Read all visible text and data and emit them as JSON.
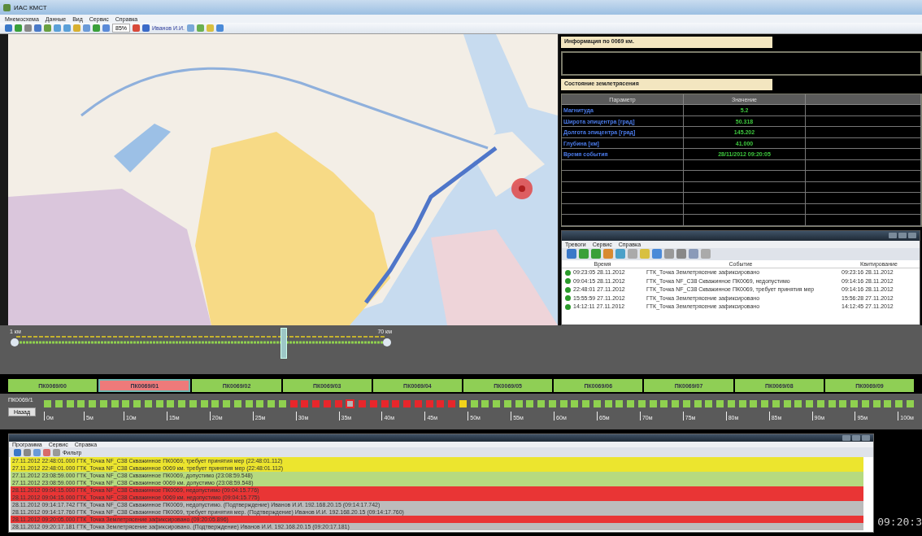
{
  "window": {
    "title": "ИАС КМСТ"
  },
  "menu": [
    "Мнемосхема",
    "Данные",
    "Вид",
    "Сервис",
    "Справка"
  ],
  "toolbar": {
    "zoom": "85%",
    "user": "Иванов И.И."
  },
  "info_panel": {
    "title": "Информация по 0069 км."
  },
  "quake_panel": {
    "title": "Состояние землетрясения",
    "columns": [
      "Параметр",
      "Значение"
    ],
    "rows": [
      {
        "parameter": "Магнитуда",
        "value": "5.2"
      },
      {
        "parameter": "Широта эпицентра [град]",
        "value": "50.318"
      },
      {
        "parameter": "Долгота эпицентра [град]",
        "value": "145.202"
      },
      {
        "parameter": "Глубина [км]",
        "value": "41.000"
      },
      {
        "parameter": "Время события",
        "value": "28/11/2012 09:20:05"
      }
    ]
  },
  "alarm_window": {
    "menu": [
      "Тревоги",
      "Сервис",
      "Справка"
    ],
    "columns": [
      "Время",
      "Событие",
      "Квитирование"
    ],
    "rows": [
      {
        "time": "09:23:05 28.11.2012",
        "event": "ГТК_Точка Землетрясение зафиксировано",
        "ack": "09:23:16 28.11.2012"
      },
      {
        "time": "09:04:15 28.11.2012",
        "event": "ГТК_Точка NF_C38 Скважинное ПК0069, недопустимо",
        "ack": "09:14:16 28.11.2012"
      },
      {
        "time": "22:48:01 27.11.2012",
        "event": "ГТК_Точка NF_C38 Скважинное ПК0069, требует принятия мер",
        "ack": "09:14:16 28.11.2012"
      },
      {
        "time": "15:55:59 27.11.2012",
        "event": "ГТК_Точка Землетрясение зафиксировано",
        "ack": "15:56:28 27.11.2012"
      },
      {
        "time": "14:12:11 27.11.2012",
        "event": "ГТК_Точка Землетрясение зафиксировано",
        "ack": "14:12:45 27.11.2012"
      }
    ]
  },
  "track": {
    "start_label": "1 км",
    "end_label": "70 км"
  },
  "segments": [
    {
      "label": "ПК0069/00",
      "selected": false
    },
    {
      "label": "ПК0069/01",
      "selected": true
    },
    {
      "label": "ПК0069/02",
      "selected": false
    },
    {
      "label": "ПК0069/03",
      "selected": false
    },
    {
      "label": "ПК0069/04",
      "selected": false
    },
    {
      "label": "ПК0069/05",
      "selected": false
    },
    {
      "label": "ПК0069/06",
      "selected": false
    },
    {
      "label": "ПК0069/07",
      "selected": false
    },
    {
      "label": "ПК0069/08",
      "selected": false
    },
    {
      "label": "ПК0069/09",
      "selected": false
    }
  ],
  "section": {
    "label": "ПК0069/1",
    "back_button": "Назад",
    "cells": [
      {
        "color": "#8fd14f",
        "selected": false
      },
      {
        "color": "#8fd14f",
        "selected": false
      },
      {
        "color": "#8fd14f",
        "selected": false
      },
      {
        "color": "#8fd14f",
        "selected": false
      },
      {
        "color": "#8fd14f",
        "selected": false
      },
      {
        "color": "#8fd14f",
        "selected": false
      },
      {
        "color": "#8fd14f",
        "selected": false
      },
      {
        "color": "#8fd14f",
        "selected": false
      },
      {
        "color": "#8fd14f",
        "selected": false
      },
      {
        "color": "#8fd14f",
        "selected": false
      },
      {
        "color": "#8fd14f",
        "selected": false
      },
      {
        "color": "#8fd14f",
        "selected": false
      },
      {
        "color": "#8fd14f",
        "selected": false
      },
      {
        "color": "#8fd14f",
        "selected": false
      },
      {
        "color": "#8fd14f",
        "selected": false
      },
      {
        "color": "#8fd14f",
        "selected": false
      },
      {
        "color": "#8fd14f",
        "selected": false
      },
      {
        "color": "#8fd14f",
        "selected": false
      },
      {
        "color": "#8fd14f",
        "selected": false
      },
      {
        "color": "#8fd14f",
        "selected": false
      },
      {
        "color": "#8fd14f",
        "selected": false
      },
      {
        "color": "#8fd14f",
        "selected": false
      },
      {
        "color": "#e8262b",
        "selected": false
      },
      {
        "color": "#e8262b",
        "selected": false
      },
      {
        "color": "#e8262b",
        "selected": false
      },
      {
        "color": "#e8262b",
        "selected": false
      },
      {
        "color": "#e8262b",
        "selected": false
      },
      {
        "color": "#e8262b",
        "selected": true
      },
      {
        "color": "#e8262b",
        "selected": false
      },
      {
        "color": "#e8262b",
        "selected": false
      },
      {
        "color": "#e8262b",
        "selected": false
      },
      {
        "color": "#e8262b",
        "selected": false
      },
      {
        "color": "#e8262b",
        "selected": false
      },
      {
        "color": "#e8262b",
        "selected": false
      },
      {
        "color": "#e8262b",
        "selected": false
      },
      {
        "color": "#e8262b",
        "selected": false
      },
      {
        "color": "#e8262b",
        "selected": false
      },
      {
        "color": "#f2d21a",
        "selected": false
      },
      {
        "color": "#8fd14f",
        "selected": false
      },
      {
        "color": "#8fd14f",
        "selected": false
      },
      {
        "color": "#8fd14f",
        "selected": false
      },
      {
        "color": "#8fd14f",
        "selected": false
      },
      {
        "color": "#8fd14f",
        "selected": false
      },
      {
        "color": "#8fd14f",
        "selected": false
      },
      {
        "color": "#8fd14f",
        "selected": false
      },
      {
        "color": "#8fd14f",
        "selected": false
      },
      {
        "color": "#8fd14f",
        "selected": false
      },
      {
        "color": "#8fd14f",
        "selected": false
      },
      {
        "color": "#8fd14f",
        "selected": false
      },
      {
        "color": "#8fd14f",
        "selected": false
      },
      {
        "color": "#8fd14f",
        "selected": false
      },
      {
        "color": "#8fd14f",
        "selected": false
      },
      {
        "color": "#8fd14f",
        "selected": false
      },
      {
        "color": "#8fd14f",
        "selected": false
      },
      {
        "color": "#8fd14f",
        "selected": false
      },
      {
        "color": "#8fd14f",
        "selected": false
      },
      {
        "color": "#8fd14f",
        "selected": false
      },
      {
        "color": "#8fd14f",
        "selected": false
      },
      {
        "color": "#8fd14f",
        "selected": false
      },
      {
        "color": "#8fd14f",
        "selected": false
      },
      {
        "color": "#8fd14f",
        "selected": false
      },
      {
        "color": "#8fd14f",
        "selected": false
      },
      {
        "color": "#8fd14f",
        "selected": false
      },
      {
        "color": "#8fd14f",
        "selected": false
      },
      {
        "color": "#8fd14f",
        "selected": false
      },
      {
        "color": "#8fd14f",
        "selected": false
      },
      {
        "color": "#8fd14f",
        "selected": false
      },
      {
        "color": "#8fd14f",
        "selected": false
      },
      {
        "color": "#8fd14f",
        "selected": false
      },
      {
        "color": "#8fd14f",
        "selected": false
      },
      {
        "color": "#8fd14f",
        "selected": false
      },
      {
        "color": "#8fd14f",
        "selected": false
      },
      {
        "color": "#8fd14f",
        "selected": false
      },
      {
        "color": "#8fd14f",
        "selected": false
      },
      {
        "color": "#8fd14f",
        "selected": false
      },
      {
        "color": "#8fd14f",
        "selected": false
      },
      {
        "color": "#8fd14f",
        "selected": false
      },
      {
        "color": "#8fd14f",
        "selected": false
      }
    ],
    "ticks": [
      "0м",
      "5м",
      "10м",
      "15м",
      "20м",
      "25м",
      "30м",
      "35м",
      "40м",
      "45м",
      "50м",
      "55м",
      "60м",
      "65м",
      "70м",
      "75м",
      "80м",
      "85м",
      "90м",
      "95м",
      "100м"
    ]
  },
  "log_window": {
    "menu": [
      "Программа",
      "Сервис",
      "Справка"
    ],
    "filter": "Фильтр",
    "rows": [
      {
        "text": "27.11.2012 22:48:01.000 ГТК_Точка NF_C38 Скважинное ПК0069, требует принятия мер (22:48:01.112)",
        "color": "#ece52e"
      },
      {
        "text": "27.11.2012 22:48:01.000 ГТК_Точка NF_C38 Скважинное 0069 км. требует принятия мер (22:48:01.112)",
        "color": "#ece52e"
      },
      {
        "text": "27.11.2012 23:08:59.000 ГТК_Точка NF_C38 Скважинное ПК0069, допустимо (23:08:59.548)",
        "color": "#b6da80"
      },
      {
        "text": "27.11.2012 23:08:59.000 ГТК_Точка NF_C38 Скважинное 0069 км. допустимо (23:08:59.548)",
        "color": "#b6da80"
      },
      {
        "text": "28.11.2012 09:04:15.000 ГТК_Точка NF_C38 Скважинное ПК0069, недопустимо (09:04:15.776)",
        "color": "#e93535"
      },
      {
        "text": "28.11.2012 09:04:15.000 ГТК_Точка NF_C38 Скважинное 0069 км. недопустимо (09:04:15.775)",
        "color": "#e93535"
      },
      {
        "text": "28.11.2012 09:14:17.742 ГТК_Точка NF_C38 Скважинное ПК0069, недопустимо. (Подтверждение) Иванов И.И. 192.168.20.15 (09:14:17.742)",
        "color": "#bcbcbc"
      },
      {
        "text": "28.11.2012 09:14:17.760 ГТК_Точка NF_C38 Скважинное ПК0069, требует принятия мер. (Подтверждение) Иванов И.И. 192.168.20.15 (09:14:17.760)",
        "color": "#bcbcbc"
      },
      {
        "text": "28.11.2012 09:20:05.000 ГТК_Точка Землетрясение зафиксировано (09:20:05.896)",
        "color": "#e93535"
      },
      {
        "text": "28.11.2012 09:20:17.181 ГТК_Точка Землетрясение зафиксировано. (Подтверждение) Иванов И.И. 192.168.20.15 (09:20:17.181)",
        "color": "#bcbcbc"
      }
    ]
  },
  "clock": "09:20:3"
}
